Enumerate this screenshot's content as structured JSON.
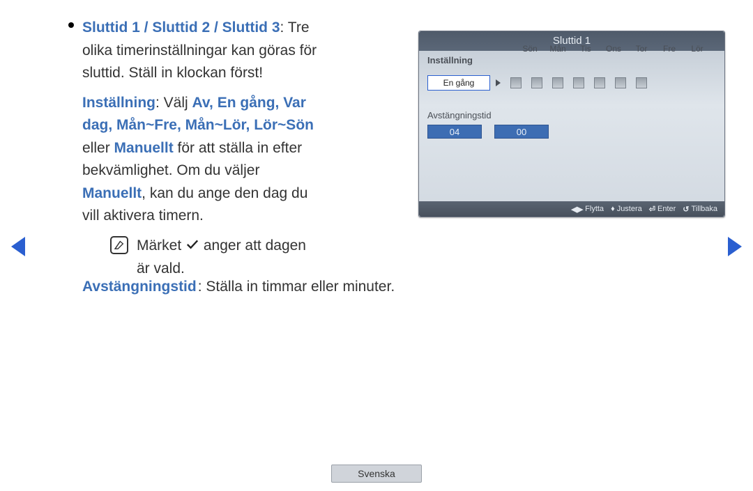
{
  "text": {
    "heading_blue": "Sluttid 1 / Sluttid 2 / Sluttid 3",
    "heading_rest": ": Tre olika timerinställningar kan göras för sluttid. Ställ in klockan först!",
    "installning_label": "Inställning",
    "installning_sep": ": Välj ",
    "options_blue": "Av, En gång, Var dag, Mån~Fre, Mån~Lör, Lör~Sön",
    "eller": " eller ",
    "manuellt": "Manuellt",
    "after_manuellt_1": " för att ställa in efter bekvämlighet. Om du väljer ",
    "manuellt2": "Manuellt",
    "after_manuellt_2": ", kan du ange den dag du vill aktivera timern.",
    "note_pre": "Märket ",
    "note_post": " anger att dagen är vald.",
    "avst_label": "Avstängningstid",
    "avst_rest": ": Ställa in timmar eller minuter."
  },
  "osd": {
    "title": "Sluttid 1",
    "installning": "Inställning",
    "selected": "En gång",
    "days": [
      "Sön",
      "Mån",
      "Tis",
      "Ons",
      "Tor",
      "Fre",
      "Lör"
    ],
    "avst": "Avstängningstid",
    "hour": "04",
    "minute": "00",
    "footer": {
      "flytta": "Flytta",
      "justera": "Justera",
      "enter": "Enter",
      "tillbaka": "Tillbaka"
    }
  },
  "lang": "Svenska"
}
